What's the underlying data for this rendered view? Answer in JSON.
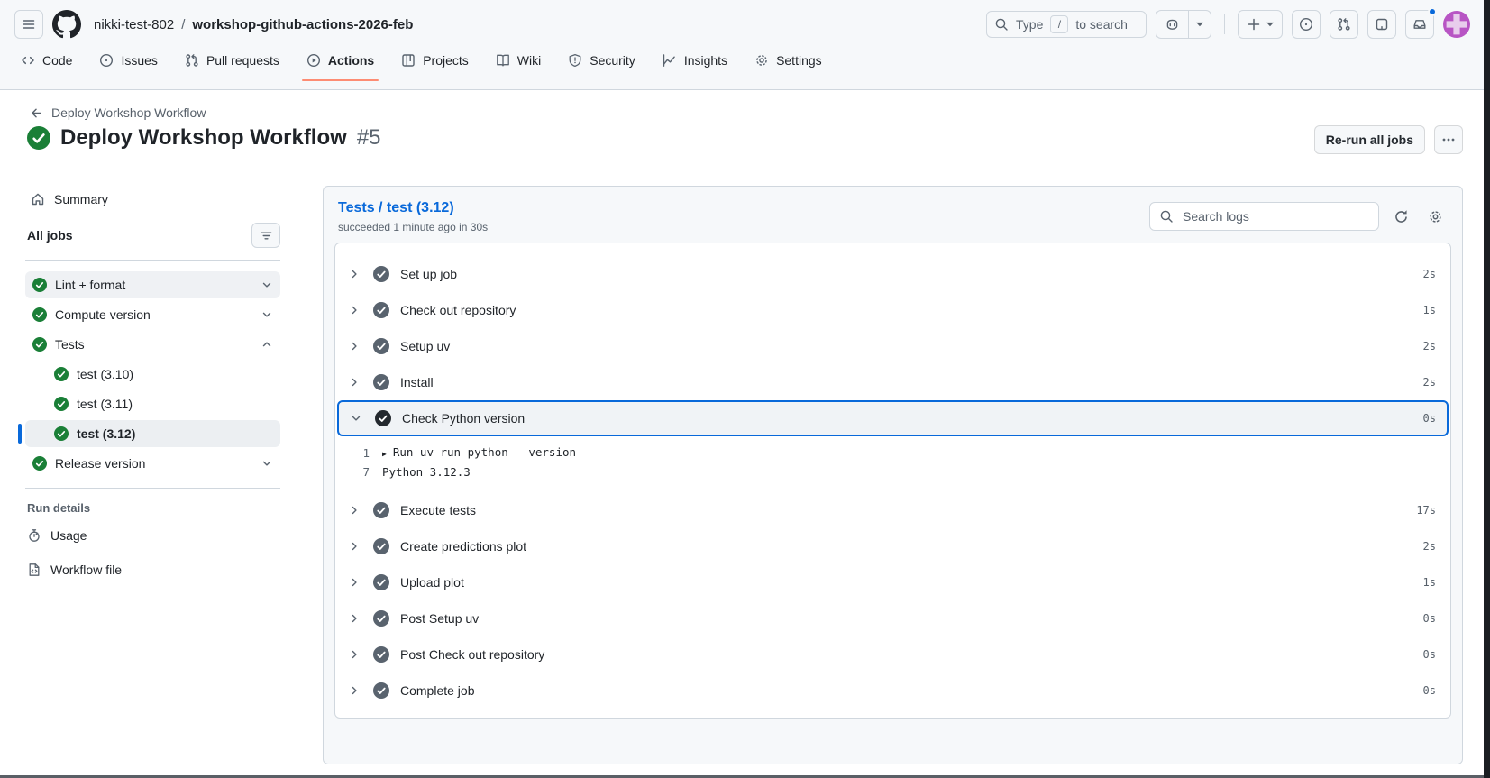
{
  "colors": {
    "accent": "#0969da",
    "success_green": "#1a7f37",
    "step_gray": "#59636e",
    "tab_underline": "#fd8c73",
    "avatar_purple": "#b855c4"
  },
  "header": {
    "owner": "nikki-test-802",
    "separator": "/",
    "repo": "workshop-github-actions-2026-feb",
    "search_pre": "Type",
    "search_key": "/",
    "search_post": "to search"
  },
  "tabs": [
    {
      "label": "Code"
    },
    {
      "label": "Issues"
    },
    {
      "label": "Pull requests"
    },
    {
      "label": "Actions"
    },
    {
      "label": "Projects"
    },
    {
      "label": "Wiki"
    },
    {
      "label": "Security"
    },
    {
      "label": "Insights"
    },
    {
      "label": "Settings"
    }
  ],
  "run": {
    "breadcrumb": "Deploy Workshop Workflow",
    "title": "Deploy Workshop Workflow",
    "number": "#5",
    "rerun_label": "Re-run all jobs"
  },
  "sidebar": {
    "summary": "Summary",
    "all_jobs": "All jobs",
    "jobs": [
      {
        "label": "Lint + format"
      },
      {
        "label": "Compute version"
      },
      {
        "label": "Tests"
      },
      {
        "label": "test (3.10)"
      },
      {
        "label": "test (3.11)"
      },
      {
        "label": "test (3.12)"
      },
      {
        "label": "Release version"
      }
    ],
    "run_details": "Run details",
    "usage": "Usage",
    "workflow_file": "Workflow file"
  },
  "job_panel": {
    "title": "Tests / test (3.12)",
    "subtitle": "succeeded 1 minute ago in 30s",
    "search_placeholder": "Search logs",
    "steps": [
      {
        "name": "Set up job",
        "duration": "2s"
      },
      {
        "name": "Check out repository",
        "duration": "1s"
      },
      {
        "name": "Setup uv",
        "duration": "2s"
      },
      {
        "name": "Install",
        "duration": "2s"
      },
      {
        "name": "Check Python version",
        "duration": "0s",
        "log": [
          {
            "num": "1",
            "text": "Run uv run python --version"
          },
          {
            "num": "7",
            "text": "Python 3.12.3"
          }
        ]
      },
      {
        "name": "Execute tests",
        "duration": "17s"
      },
      {
        "name": "Create predictions plot",
        "duration": "2s"
      },
      {
        "name": "Upload plot",
        "duration": "1s"
      },
      {
        "name": "Post Setup uv",
        "duration": "0s"
      },
      {
        "name": "Post Check out repository",
        "duration": "0s"
      },
      {
        "name": "Complete job",
        "duration": "0s"
      }
    ]
  }
}
